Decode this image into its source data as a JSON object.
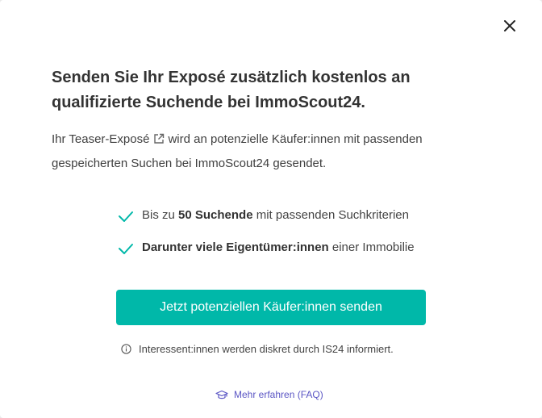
{
  "colors": {
    "accent": "#00b8a9",
    "link": "#5a55c4",
    "check": "#00b8a9"
  },
  "modal": {
    "close_icon": "close-icon",
    "title_line1": "Senden Sie Ihr Exposé zusätzlich kostenlos an",
    "title_line2": "qualifizierte Suchende bei ImmoScout24.",
    "desc_part1": "Ihr Teaser-Exposé",
    "desc_part2": "wird an potenzielle Käufer:innen mit passenden",
    "desc_line2": "gespeicherten Suchen bei ImmoScout24 gesendet.",
    "external_link_icon": "external-link-icon",
    "benefits": [
      {
        "icon": "check-icon",
        "pre": "Bis zu ",
        "bold": "50 Suchende",
        "post": " mit passenden Suchkriterien"
      },
      {
        "icon": "check-icon",
        "pre": "",
        "bold": "Darunter viele Eigentümer:innen",
        "post": " einer Immobilie"
      }
    ],
    "cta_label": "Jetzt potenziellen Käufer:innen senden",
    "info_icon": "info-icon",
    "info_text": "Interessent:innen werden diskret durch IS24 informiert.",
    "faq_icon": "graduation-cap-icon",
    "faq_label": "Mehr erfahren (FAQ)"
  }
}
